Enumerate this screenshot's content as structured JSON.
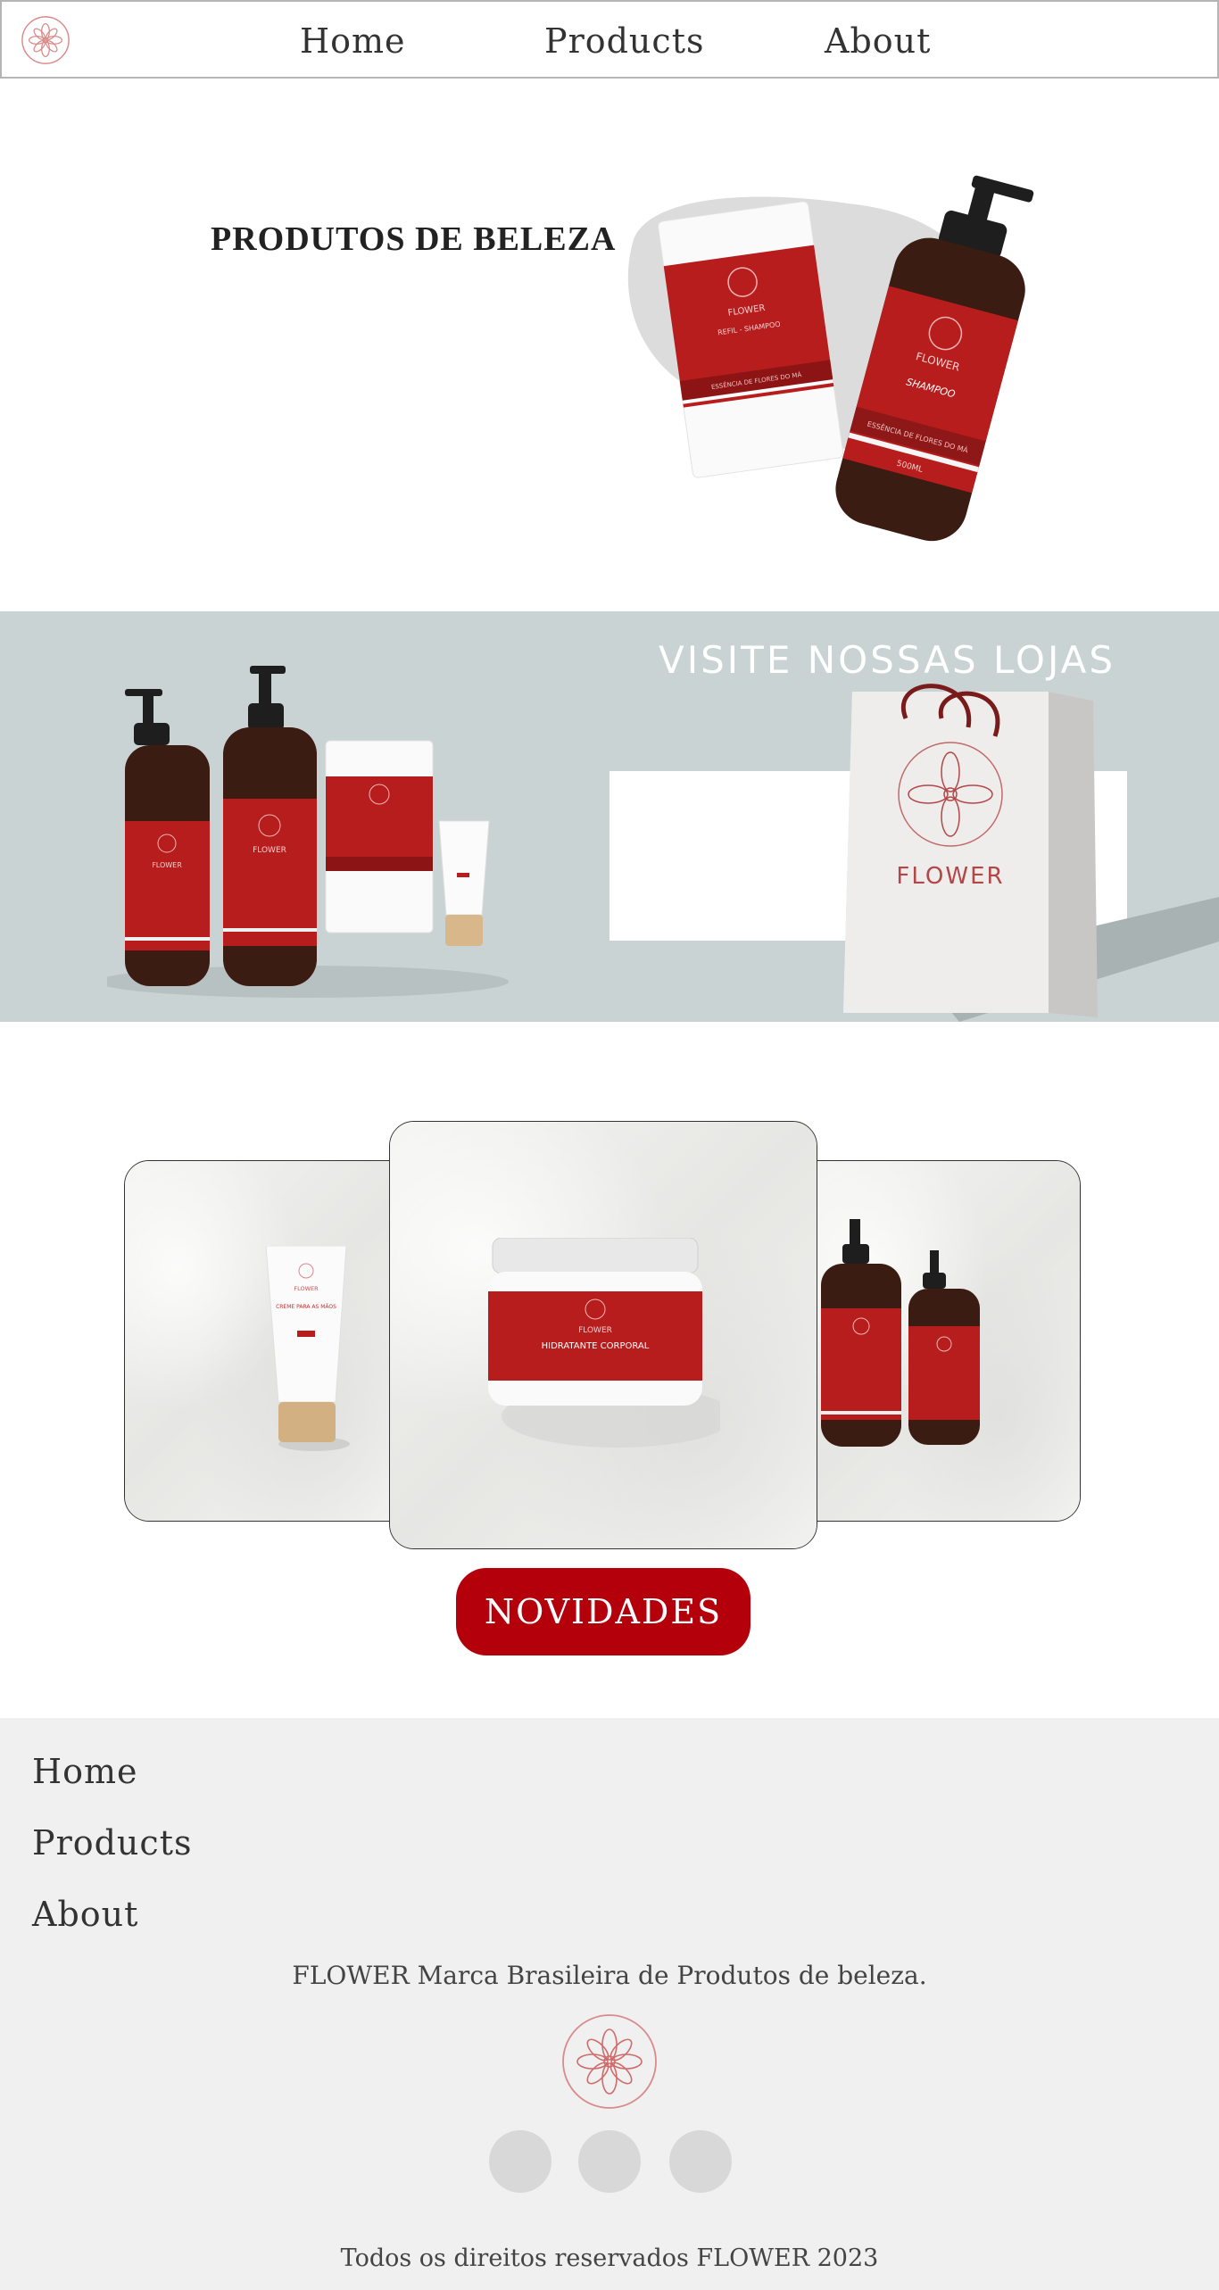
{
  "header": {
    "nav": [
      {
        "label": "Home"
      },
      {
        "label": "Products"
      },
      {
        "label": "About"
      }
    ]
  },
  "hero": {
    "title": "PRODUTOS DE BELEZA",
    "refill_pack": {
      "brand": "FLOWER",
      "product": "REFIL - SHAMPOO",
      "line": "ESSÊNCIA DE FLORES DO MÁ"
    },
    "bottle": {
      "brand": "FLOWER",
      "product": "SHAMPOO",
      "line": "ESSÊNCIA DE FLORES DO MÁ",
      "volume": "500ML"
    }
  },
  "stores": {
    "title": "VISITE NOSSAS LOJAS",
    "bag_brand": "FLOWER",
    "mini_brand": "FLOWER"
  },
  "novelties": {
    "button_label": "NOVIDADES",
    "jar_brand": "FLOWER",
    "jar_product": "HIDRATANTE CORPORAL",
    "tube_brand": "FLOWER",
    "tube_product": "CREME PARA AS MÃOS"
  },
  "footer": {
    "links": [
      {
        "label": "Home"
      },
      {
        "label": "Products"
      },
      {
        "label": "About"
      }
    ],
    "brand_text": "FLOWER Marca Brasileira de Produtos de beleza.",
    "copyright": "Todos os direitos reservados FLOWER 2023"
  },
  "colors": {
    "brand_red": "#b3000b",
    "label_red": "#b81d1d",
    "band_gray": "#c9d3d3",
    "footer_bg": "#f0f0f0"
  },
  "icons": [
    "flower-logo-icon",
    "social-icon"
  ]
}
